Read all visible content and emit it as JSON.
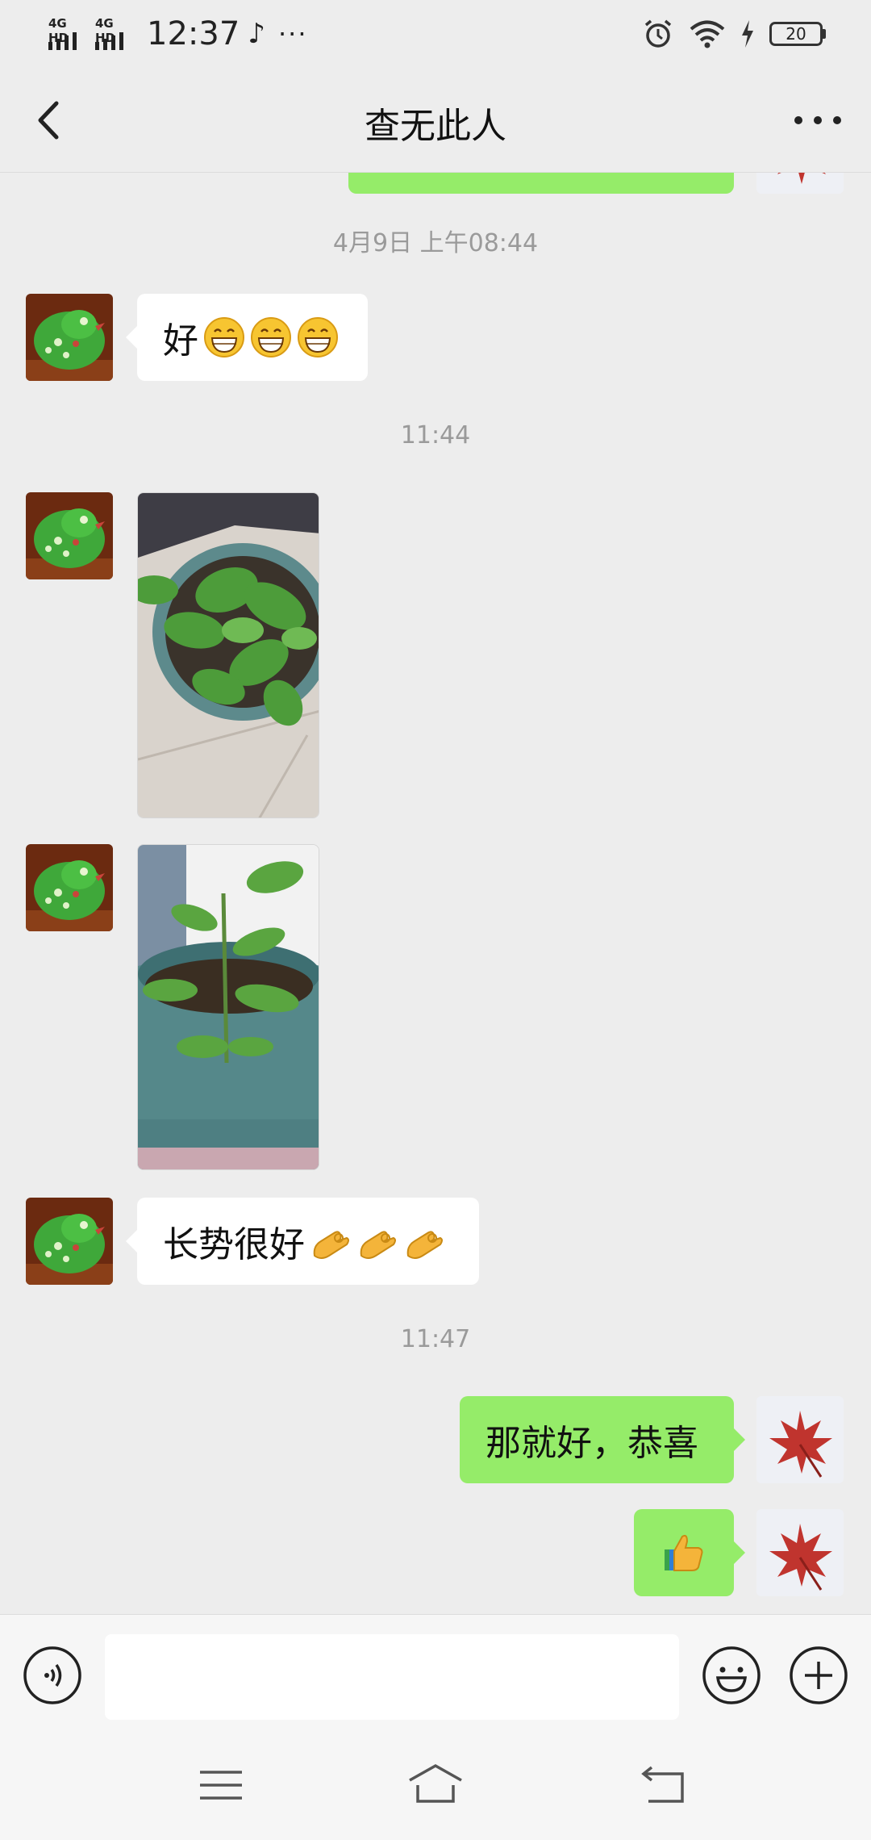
{
  "status_bar": {
    "network_1": "4G HD",
    "network_2": "4G HD",
    "time": "12:37",
    "tiktok_icon": "♪",
    "more": "···",
    "battery": "20"
  },
  "header": {
    "title": "查无此人"
  },
  "messages": {
    "time_1": "4月9日 上午08:44",
    "msg_1_text": "好",
    "time_2": "11:44",
    "msg_4_text": "长势很好",
    "time_3": "11:47",
    "msg_5_text": "那就好，恭喜"
  },
  "icons": {
    "back": "back-icon",
    "more": "more-icon",
    "voice": "voice-icon",
    "emoji": "emoji-icon",
    "plus": "plus-icon",
    "menu": "menu-icon",
    "home": "home-icon",
    "return": "return-icon"
  },
  "colors": {
    "background": "#ededed",
    "incoming_bubble": "#ffffff",
    "outgoing_bubble": "#95ec69",
    "timestamp": "#9a9a9a"
  }
}
